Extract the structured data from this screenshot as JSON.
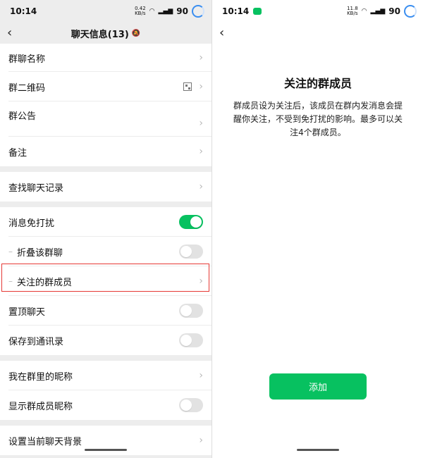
{
  "left": {
    "status": {
      "time": "10:14",
      "net_speed_top": "0.42",
      "net_speed_bottom": "KB/s",
      "battery": "90"
    },
    "nav": {
      "title": "聊天信息(13)"
    },
    "rows": {
      "group_name": "群聊名称",
      "group_qr": "群二维码",
      "group_notice": "群公告",
      "remark": "备注",
      "find_history": "查找聊天记录",
      "mute": "消息免打扰",
      "fold": "折叠该群聊",
      "followed_members": "关注的群成员",
      "pin": "置顶聊天",
      "save_contacts": "保存到通讯录",
      "my_nickname": "我在群里的昵称",
      "show_nicknames": "显示群成员昵称",
      "set_background": "设置当前聊天背景"
    },
    "toggles": {
      "mute": true,
      "fold": false,
      "pin": false,
      "save_contacts": false,
      "show_nicknames": false
    }
  },
  "right": {
    "status": {
      "time": "10:14",
      "net_speed_top": "11.8",
      "net_speed_bottom": "KB/s",
      "battery": "90"
    },
    "title": "关注的群成员",
    "description": "群成员设为关注后，该成员在群内发消息会提醒你关注，不受到免打扰的影响。最多可以关注4个群成员。",
    "add_button": "添加"
  },
  "colors": {
    "accent": "#07c160",
    "highlight": "#e53935",
    "background": "#ededed"
  }
}
